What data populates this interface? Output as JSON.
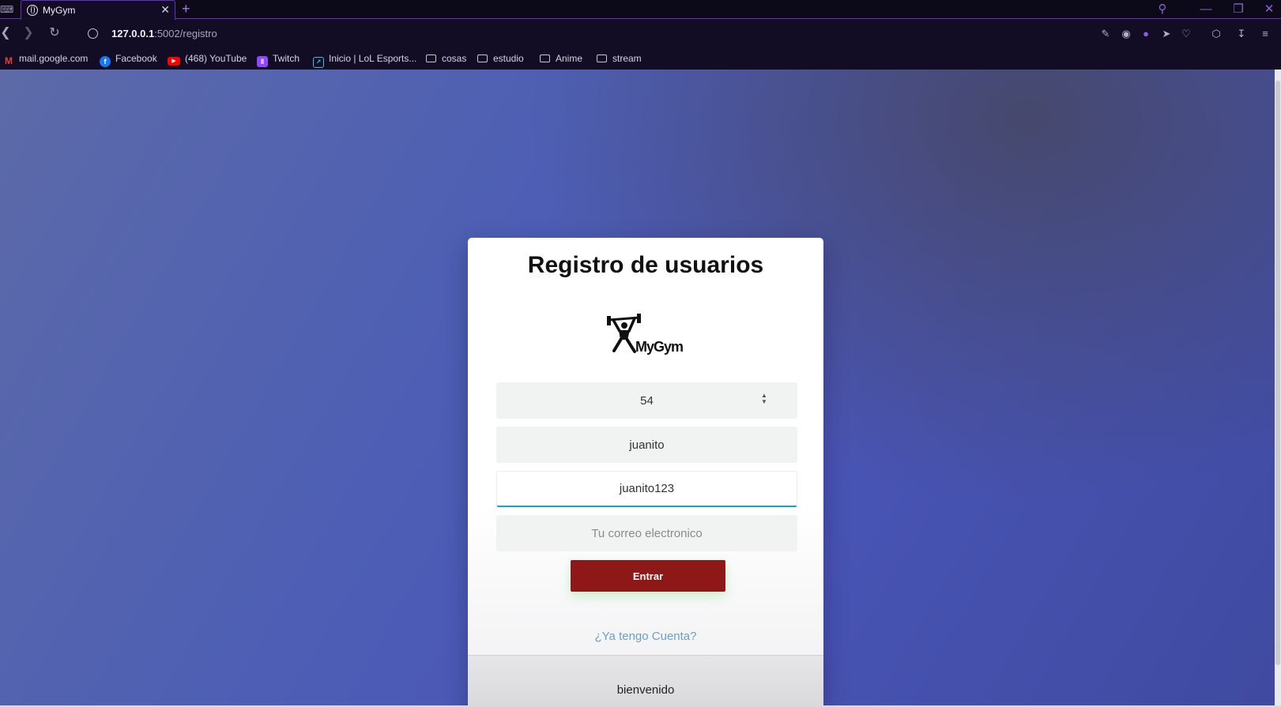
{
  "browser": {
    "tab_title": "MyGym",
    "url_host": "127.0.0.1",
    "url_rest": ":5002/registro",
    "bookmarks": [
      {
        "label": "mail.google.com",
        "icon": "gmail-icon"
      },
      {
        "label": "Facebook",
        "icon": "facebook-icon"
      },
      {
        "label": "(468) YouTube",
        "icon": "youtube-icon"
      },
      {
        "label": "Twitch",
        "icon": "twitch-icon"
      },
      {
        "label": "Inicio | LoL Esports...",
        "icon": "lol-esports-icon"
      },
      {
        "label": "cosas",
        "icon": "folder-icon"
      },
      {
        "label": "estudio",
        "icon": "folder-icon"
      },
      {
        "label": "Anime",
        "icon": "folder-icon"
      },
      {
        "label": "stream",
        "icon": "folder-icon"
      }
    ],
    "accent_color": "#6a2fc0"
  },
  "form": {
    "title": "Registro de usuarios",
    "logo_text": "MyGym",
    "number_value": "54",
    "username_value": "juanito",
    "password_value": "juanito123",
    "email_placeholder": "Tu correo electronico",
    "submit_label": "Entrar",
    "login_link": "¿Ya tengo Cuenta?",
    "footer_text": "bienvenido",
    "button_color": "#8e1717",
    "link_color": "#6a9fc4"
  }
}
